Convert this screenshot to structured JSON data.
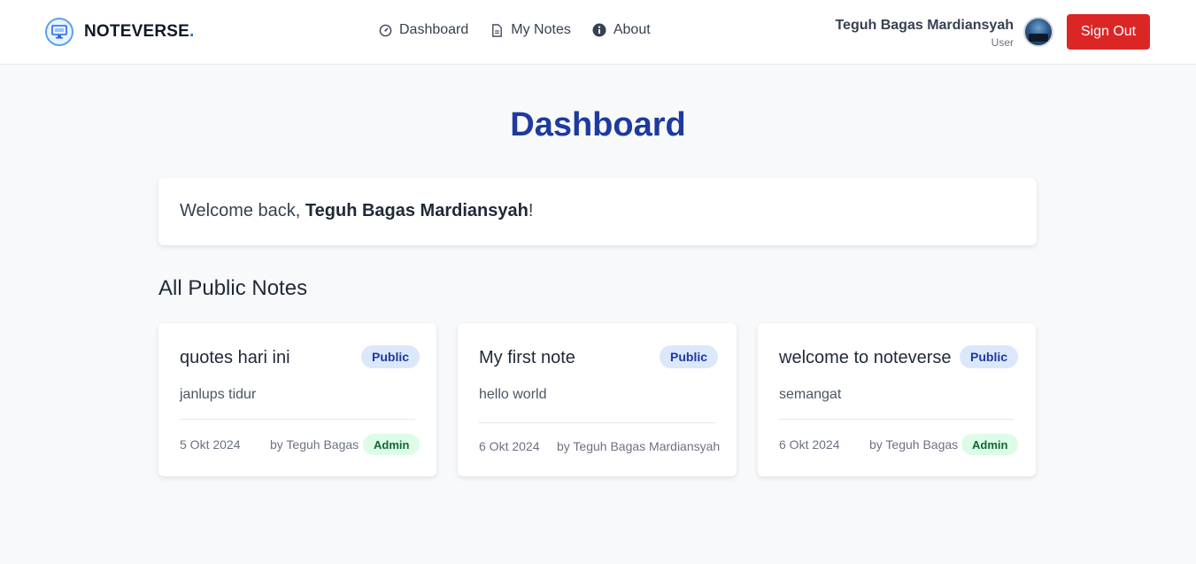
{
  "brand": {
    "name": "NOTEVERSE",
    "dot": ".",
    "icon": "monitor-icon"
  },
  "nav": {
    "items": [
      {
        "label": "Dashboard",
        "icon": "gauge-icon"
      },
      {
        "label": "My Notes",
        "icon": "document-icon"
      },
      {
        "label": "About",
        "icon": "info-icon"
      }
    ]
  },
  "user": {
    "name": "Teguh Bagas Mardiansyah",
    "role": "User",
    "sign_out_label": "Sign Out"
  },
  "page": {
    "title": "Dashboard",
    "welcome_prefix": "Welcome back, ",
    "welcome_name": "Teguh Bagas Mardiansyah",
    "welcome_suffix": "!",
    "section_title": "All Public Notes"
  },
  "notes": [
    {
      "title": "quotes hari ini",
      "visibility": "Public",
      "body": "janlups tidur",
      "date": "5 Okt 2024",
      "author": "by Teguh Bagas",
      "role_badge": "Admin"
    },
    {
      "title": "My first note",
      "visibility": "Public",
      "body": "hello world",
      "date": "6 Okt 2024",
      "author": "by Teguh Bagas Mardiansyah",
      "role_badge": ""
    },
    {
      "title": "welcome to noteverse",
      "visibility": "Public",
      "body": "semangat",
      "date": "6 Okt 2024",
      "author": "by Teguh Bagas",
      "role_badge": "Admin"
    }
  ],
  "colors": {
    "accent": "#1e3a9e",
    "danger": "#dc2626",
    "public_badge": "#dbe7fb",
    "admin_badge": "#dcfce7"
  }
}
